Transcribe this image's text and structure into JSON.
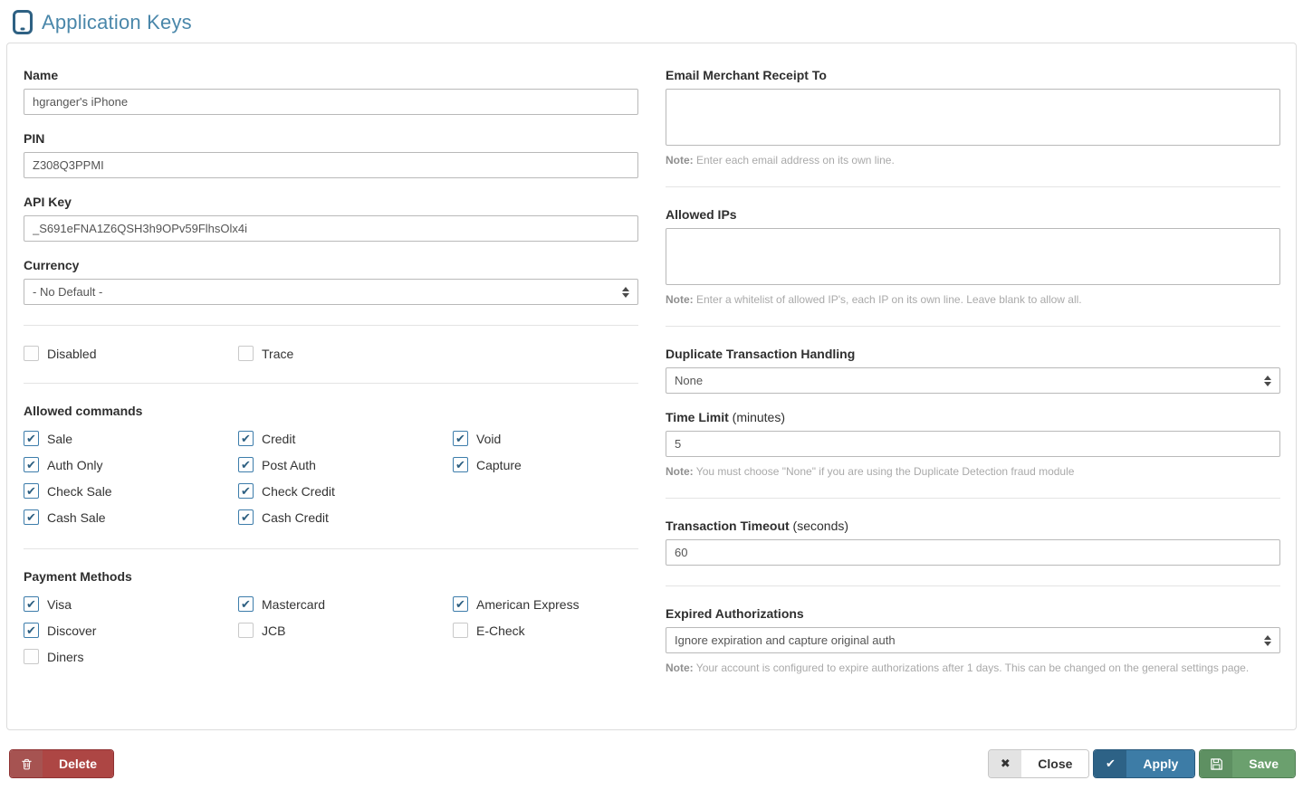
{
  "header": {
    "title": "Application Keys"
  },
  "left": {
    "name": {
      "label": "Name",
      "value": "hgranger's iPhone"
    },
    "pin": {
      "label": "PIN",
      "value": "Z308Q3PPMI"
    },
    "api_key": {
      "label": "API Key",
      "value": "_S691eFNA1Z6QSH3h9OPv59FlhsOlx4i"
    },
    "currency": {
      "label": "Currency",
      "value": "- No Default -"
    },
    "flags": {
      "columns": [
        [
          {
            "label": "Disabled",
            "checked": false
          }
        ],
        [
          {
            "label": "Trace",
            "checked": false
          }
        ]
      ]
    },
    "allowed_commands": {
      "title": "Allowed commands",
      "columns": [
        [
          {
            "label": "Sale",
            "checked": true
          },
          {
            "label": "Auth Only",
            "checked": true
          },
          {
            "label": "Check Sale",
            "checked": true
          },
          {
            "label": "Cash Sale",
            "checked": true
          }
        ],
        [
          {
            "label": "Credit",
            "checked": true
          },
          {
            "label": "Post Auth",
            "checked": true
          },
          {
            "label": "Check Credit",
            "checked": true
          },
          {
            "label": "Cash Credit",
            "checked": true
          }
        ],
        [
          {
            "label": "Void",
            "checked": true
          },
          {
            "label": "Capture",
            "checked": true
          }
        ]
      ]
    },
    "payment_methods": {
      "title": "Payment Methods",
      "columns": [
        [
          {
            "label": "Visa",
            "checked": true
          },
          {
            "label": "Discover",
            "checked": true
          },
          {
            "label": "Diners",
            "checked": false
          }
        ],
        [
          {
            "label": "Mastercard",
            "checked": true
          },
          {
            "label": "JCB",
            "checked": false
          }
        ],
        [
          {
            "label": "American Express",
            "checked": true
          },
          {
            "label": "E-Check",
            "checked": false
          }
        ]
      ]
    }
  },
  "right": {
    "email_receipt": {
      "label": "Email Merchant Receipt To",
      "value": "",
      "note_prefix": "Note:",
      "note": " Enter each email address on its own line."
    },
    "allowed_ips": {
      "label": "Allowed IPs",
      "value": "",
      "note_prefix": "Note:",
      "note": " Enter a whitelist of allowed IP's, each IP on its own line. Leave blank to allow all."
    },
    "duplicate_handling": {
      "label": "Duplicate Transaction Handling",
      "value": "None"
    },
    "time_limit": {
      "label": "Time Limit",
      "suffix": " (minutes)",
      "value": "5",
      "note_prefix": "Note:",
      "note": " You must choose \"None\" if you are using the Duplicate Detection fraud module"
    },
    "transaction_timeout": {
      "label": "Transaction Timeout",
      "suffix": " (seconds)",
      "value": "60"
    },
    "expired_auth": {
      "label": "Expired Authorizations",
      "value": "Ignore expiration and capture original auth",
      "note_prefix": "Note:",
      "note": " Your account is configured to expire authorizations after 1 days. This can be changed on the general settings page."
    }
  },
  "footer": {
    "delete_label": "Delete",
    "close_label": "Close",
    "apply_label": "Apply",
    "save_label": "Save",
    "close_icon": "✖",
    "apply_icon": "✔"
  },
  "colors": {
    "title_blue": "#4a87aa",
    "checkbox_blue_border": "#3d7dab",
    "checkbox_check": "#2d5f81",
    "delete_red": "#ad4644",
    "apply_blue": "#3d7ca6",
    "save_green": "#6ba06e"
  }
}
